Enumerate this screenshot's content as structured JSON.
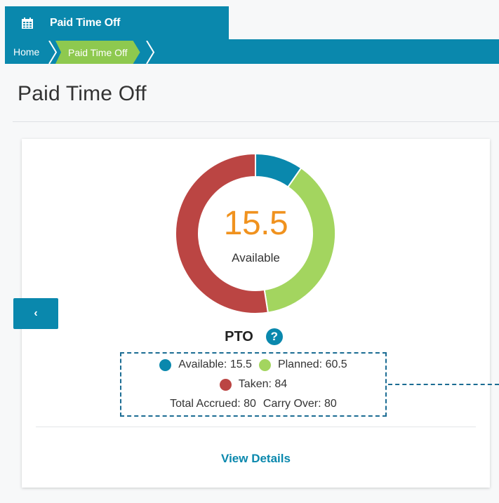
{
  "colors": {
    "primary": "#0a88ad",
    "active_breadcrumb": "#8ec94f",
    "available": "#0a88ad",
    "planned": "#a3d55f",
    "taken": "#bb4543",
    "accent_value": "#f0921e"
  },
  "top_tab": {
    "icon": "calendar-icon",
    "title": "Paid Time Off"
  },
  "breadcrumb": {
    "home": "Home",
    "current": "Paid Time Off"
  },
  "page": {
    "title": "Paid Time Off"
  },
  "card": {
    "center_value": "15.5",
    "center_label": "Available",
    "plan_name": "PTO",
    "help_icon": "question-circle-icon",
    "prev_icon": "chevron-left-icon",
    "prev_glyph": "‹",
    "legend": {
      "available": "Available: 15.5",
      "planned": "Planned: 60.5",
      "taken": "Taken: 84",
      "total_accrued": "Total Accrued: 80",
      "carry_over": "Carry Over: 80"
    },
    "view_details": "View Details"
  },
  "chart_data": {
    "type": "pie",
    "categories": [
      "Available",
      "Planned",
      "Taken"
    ],
    "values": [
      15.5,
      60.5,
      84
    ]
  }
}
